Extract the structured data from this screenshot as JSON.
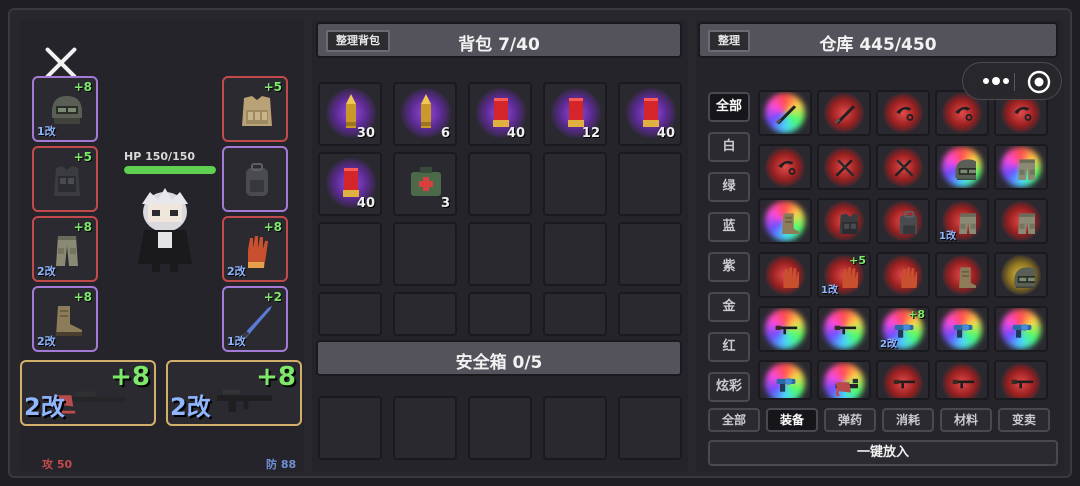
{
  "colors": {
    "accent_green": "#5fd04f",
    "bonus_green": "#7de86a",
    "mod_blue": "#8fb6ff",
    "attack_red": "#c14a4a",
    "defense_blue": "#6f8fd6"
  },
  "equipment": {
    "close_icon": "close-icon",
    "hp_text": "HP 150/150",
    "hp_fraction": 1.0,
    "left_slots": [
      {
        "name": "helmet",
        "icon": "helmet-icon",
        "bonus": "+8",
        "mod": "1改",
        "rarity": "purple"
      },
      {
        "name": "armor",
        "icon": "armor-vest-icon",
        "bonus": "+5",
        "mod": "",
        "rarity": "red"
      },
      {
        "name": "pants",
        "icon": "pants-icon",
        "bonus": "+8",
        "mod": "2改",
        "rarity": "red"
      },
      {
        "name": "boots",
        "icon": "boots-icon",
        "bonus": "+8",
        "mod": "2改",
        "rarity": "purple"
      }
    ],
    "right_slots": [
      {
        "name": "vest",
        "icon": "tactical-vest-icon",
        "bonus": "+5",
        "mod": "",
        "rarity": "red"
      },
      {
        "name": "backpack",
        "icon": "backpack-icon",
        "bonus": "",
        "mod": "",
        "rarity": "purple"
      },
      {
        "name": "gloves",
        "icon": "gloves-icon",
        "bonus": "+8",
        "mod": "2改",
        "rarity": "red"
      },
      {
        "name": "melee",
        "icon": "blade-icon",
        "bonus": "+2",
        "mod": "1改",
        "rarity": "purple"
      }
    ],
    "weapons": [
      {
        "name": "primary",
        "icon": "sniper-rifle-icon",
        "bonus": "+8",
        "mod": "2改"
      },
      {
        "name": "secondary",
        "icon": "assault-rifle-icon",
        "bonus": "+8",
        "mod": "2改"
      }
    ],
    "attack": "攻 50",
    "defense": "防 88"
  },
  "backpack": {
    "sort_label": "整理背包",
    "title": "背包 7/40",
    "items": [
      {
        "icon": "rifle-ammo-icon",
        "qty": "30",
        "glow": "purple"
      },
      {
        "icon": "rifle-ammo-icon",
        "qty": "6",
        "glow": "purple"
      },
      {
        "icon": "shotgun-shell-icon",
        "qty": "40",
        "glow": "purple"
      },
      {
        "icon": "shotgun-shell-icon",
        "qty": "12",
        "glow": "purple"
      },
      {
        "icon": "shotgun-shell-icon",
        "qty": "40",
        "glow": "purple"
      },
      {
        "icon": "shotgun-shell-icon",
        "qty": "40",
        "glow": "purple"
      },
      {
        "icon": "medkit-icon",
        "qty": "3",
        "glow": "none"
      }
    ]
  },
  "safebox": {
    "title": "安全箱 0/5"
  },
  "warehouse": {
    "sort_label": "整理",
    "title": "仓库 445/450",
    "filters": [
      "全部",
      "白",
      "绿",
      "蓝",
      "紫",
      "金",
      "红",
      "炫彩"
    ],
    "tabs": [
      "全部",
      "装备",
      "弹药",
      "消耗",
      "材料",
      "变卖"
    ],
    "active_tab": "装备",
    "put_all_label": "一键放入",
    "items": [
      {
        "icon": "sword-icon",
        "glow": "rainbow",
        "bonus": "",
        "mod": ""
      },
      {
        "icon": "sword-icon",
        "glow": "red",
        "bonus": "",
        "mod": ""
      },
      {
        "icon": "karambit-icon",
        "glow": "red",
        "bonus": "",
        "mod": ""
      },
      {
        "icon": "karambit-icon",
        "glow": "red",
        "bonus": "",
        "mod": ""
      },
      {
        "icon": "karambit-icon",
        "glow": "red",
        "bonus": "",
        "mod": ""
      },
      {
        "icon": "karambit-icon",
        "glow": "red",
        "bonus": "",
        "mod": ""
      },
      {
        "icon": "dual-blades-icon",
        "glow": "red",
        "bonus": "",
        "mod": ""
      },
      {
        "icon": "dual-blades-icon",
        "glow": "red",
        "bonus": "",
        "mod": ""
      },
      {
        "icon": "helmet-icon",
        "glow": "rainbow",
        "bonus": "",
        "mod": ""
      },
      {
        "icon": "pants-icon",
        "glow": "rainbow",
        "bonus": "",
        "mod": ""
      },
      {
        "icon": "boots-icon",
        "glow": "rainbow",
        "bonus": "",
        "mod": ""
      },
      {
        "icon": "armor-vest-icon",
        "glow": "red",
        "bonus": "",
        "mod": ""
      },
      {
        "icon": "backpack-icon",
        "glow": "red",
        "bonus": "",
        "mod": ""
      },
      {
        "icon": "pants-icon",
        "glow": "red",
        "bonus": "",
        "mod": "1改"
      },
      {
        "icon": "pants-icon",
        "glow": "red",
        "bonus": "",
        "mod": ""
      },
      {
        "icon": "gloves-icon",
        "glow": "red",
        "bonus": "",
        "mod": ""
      },
      {
        "icon": "gloves-icon",
        "glow": "red",
        "bonus": "+5",
        "mod": "1改"
      },
      {
        "icon": "gloves-icon",
        "glow": "red",
        "bonus": "",
        "mod": ""
      },
      {
        "icon": "boots-icon",
        "glow": "red",
        "bonus": "",
        "mod": ""
      },
      {
        "icon": "helmet-icon",
        "glow": "gold",
        "bonus": "",
        "mod": ""
      },
      {
        "icon": "rifle-icon",
        "glow": "rainbow",
        "bonus": "",
        "mod": ""
      },
      {
        "icon": "rifle-icon",
        "glow": "rainbow",
        "bonus": "",
        "mod": ""
      },
      {
        "icon": "revolver-icon",
        "glow": "rainbow",
        "bonus": "+8",
        "mod": "2改"
      },
      {
        "icon": "revolver-icon",
        "glow": "rainbow",
        "bonus": "",
        "mod": ""
      },
      {
        "icon": "revolver-icon",
        "glow": "rainbow",
        "bonus": "",
        "mod": ""
      },
      {
        "icon": "revolver-icon",
        "glow": "rainbow",
        "bonus": "",
        "mod": ""
      },
      {
        "icon": "sniper-rifle-icon",
        "glow": "rainbow",
        "bonus": "",
        "mod": ""
      },
      {
        "icon": "rifle-icon",
        "glow": "red",
        "bonus": "",
        "mod": ""
      },
      {
        "icon": "rifle-icon",
        "glow": "red",
        "bonus": "",
        "mod": ""
      },
      {
        "icon": "rifle-icon",
        "glow": "red",
        "bonus": "",
        "mod": ""
      }
    ]
  },
  "capsule": {
    "more_icon": "more-dots-icon",
    "target_icon": "target-icon"
  }
}
